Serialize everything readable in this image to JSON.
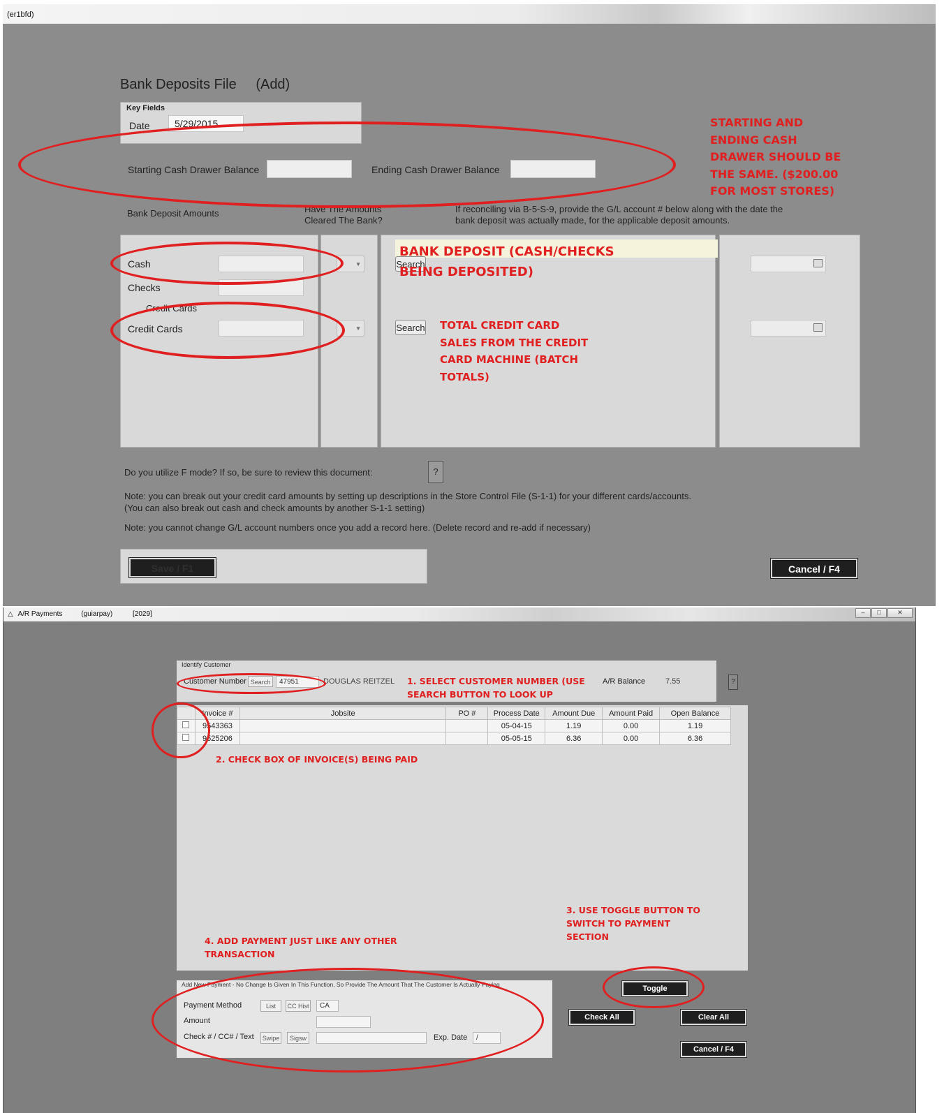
{
  "top": {
    "window_title": "(er1bfd)",
    "form_title": "Bank Deposits File",
    "form_mode": "(Add)",
    "key_fields": {
      "group_label": "Key Fields",
      "date_label": "Date",
      "date_value": "5/29/2015"
    },
    "starting_cash_label": "Starting Cash Drawer Balance",
    "ending_cash_label": "Ending Cash Drawer Balance",
    "bank_deposit_amounts_label": "Bank Deposit Amounts",
    "cleared_question": [
      "Have The Amounts",
      "Cleared The Bank?"
    ],
    "gl_note": [
      "If reconciling via B-5-S-9, provide the G/L account # below along with the date the",
      "bank deposit was actually made, for the applicable deposit amounts."
    ],
    "rows": {
      "cash": "Cash",
      "checks": "Checks",
      "credit_cards_header": "Credit Cards",
      "credit_cards": "Credit Cards"
    },
    "search_label": "Search",
    "f_mode_question": "Do you utilize F mode?  If so, be sure to review this document:",
    "help_icon": "?",
    "notes": [
      "Note: you can break out your credit card amounts by setting up descriptions in the Store Control File (S-1-1) for your different cards/accounts.",
      "(You can also break out cash and check amounts by another S-1-1 setting)",
      "Note: you cannot change G/L account numbers once you add a record here.  (Delete record and re-add if necessary)"
    ],
    "save_label": "Save / F1",
    "cancel_label": "Cancel / F4",
    "annotations": {
      "cash_drawer": [
        "STARTING AND",
        "ENDING CASH",
        "DRAWER SHOULD BE",
        "THE SAME. ($200.00",
        "FOR MOST STORES)"
      ],
      "bank_deposit": [
        "BANK DEPOSIT (CASH/CHECKS",
        "BEING DEPOSITED)"
      ],
      "credit_card": [
        "TOTAL CREDIT CARD",
        "SALES FROM THE CREDIT",
        "CARD MACHINE (BATCH",
        "TOTALS)"
      ]
    },
    "icons": {
      "dropdown": "chevron-down-icon",
      "calendar": "calendar-icon",
      "help": "help-icon"
    },
    "annotation_color": "#e02020"
  },
  "bottom": {
    "app_name": "A/R Payments",
    "program": "(guiarpay)",
    "code": "[2029]",
    "window_controls": {
      "minimize": "–",
      "maximize": "□",
      "close": "✕"
    },
    "identify_customer_label": "Identify Customer",
    "customer_number_label": "Customer Number",
    "search_label": "Search",
    "customer_number_value": "47951",
    "customer_name": "DOUGLAS REITZEL",
    "ar_balance_label": "A/R Balance",
    "ar_balance_value": "7.55",
    "help_icon": "?",
    "columns": [
      "Invoice #",
      "Jobsite",
      "PO #",
      "Process Date",
      "Amount Due",
      "Amount Paid",
      "Open Balance"
    ],
    "invoices": [
      {
        "invoice": "9543363",
        "jobsite": "",
        "po": "",
        "process_date": "05-04-15",
        "amount_due": "1.19",
        "amount_paid": "0.00",
        "open_balance": "1.19"
      },
      {
        "invoice": "9525206",
        "jobsite": "",
        "po": "",
        "process_date": "05-05-15",
        "amount_due": "6.36",
        "amount_paid": "0.00",
        "open_balance": "6.36"
      }
    ],
    "payment_header": "Add New Payment - No Change Is Given In This Function, So Provide The Amount That The Customer Is Actually Paying",
    "payment_method_label": "Payment Method",
    "list_label": "List",
    "cc_hist_label": "CC Hist",
    "payment_method_value": "CA",
    "amount_label": "Amount",
    "check_label": "Check # / CC# / Text",
    "swipe_label": "Swipe",
    "sigsw_label": "Sigsw",
    "exp_date_label": "Exp. Date",
    "exp_date_value": "/",
    "toggle_label": "Toggle",
    "check_all_label": "Check All",
    "clear_all_label": "Clear All",
    "cancel_label": "Cancel / F4",
    "annotations": {
      "step1": [
        "1. SELECT CUSTOMER NUMBER (USE",
        "SEARCH BUTTON TO LOOK UP"
      ],
      "step2": "2. CHECK BOX OF INVOICE(S) BEING PAID",
      "step3": [
        "3. USE TOGGLE BUTTON TO",
        "SWITCH TO PAYMENT",
        "SECTION"
      ],
      "step4": [
        "4. ADD PAYMENT JUST LIKE ANY OTHER",
        "TRANSACTION"
      ]
    }
  }
}
